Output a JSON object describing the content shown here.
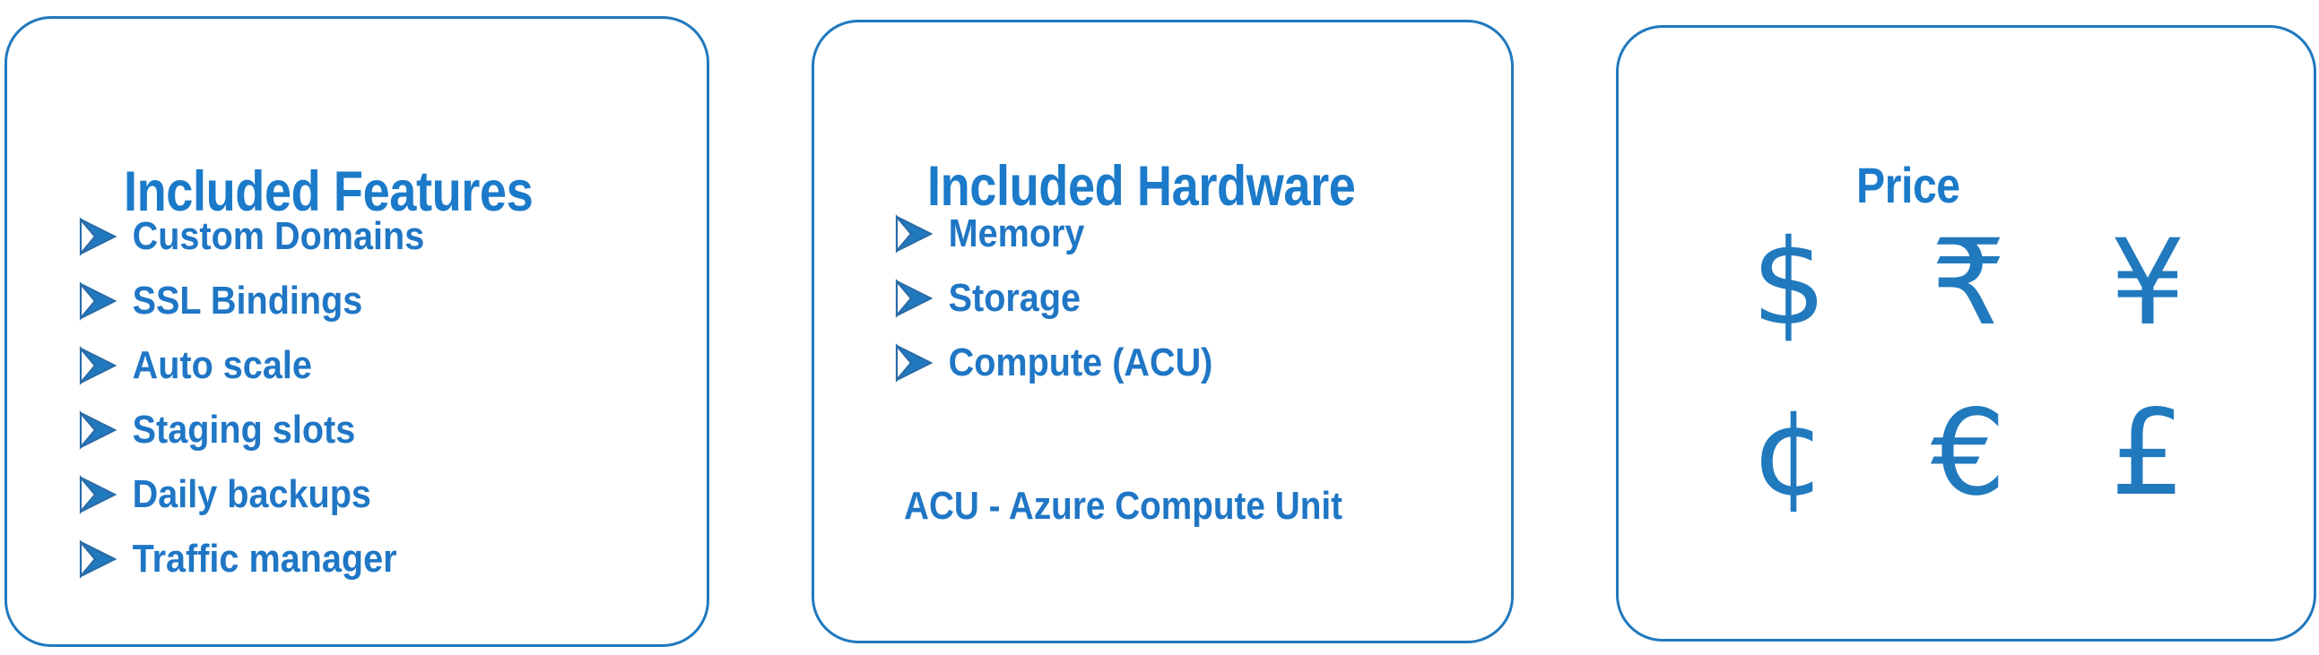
{
  "colors": {
    "border": "#2179be",
    "heading_text": "#1b7ac9",
    "body_text": "#1f76c5",
    "symbol": "#2179be",
    "background": "#ffffff"
  },
  "panels": {
    "features": {
      "title": "Included Features",
      "items": [
        {
          "bullet": "arrowhead-bullet-icon",
          "label": "Custom Domains"
        },
        {
          "bullet": "arrowhead-bullet-icon",
          "label": "SSL Bindings"
        },
        {
          "bullet": "arrowhead-bullet-icon",
          "label": "Auto scale"
        },
        {
          "bullet": "arrowhead-bullet-icon",
          "label": "Staging slots"
        },
        {
          "bullet": "arrowhead-bullet-icon",
          "label": "Daily backups"
        },
        {
          "bullet": "arrowhead-bullet-icon",
          "label": "Traffic manager"
        }
      ]
    },
    "hardware": {
      "title": "Included Hardware",
      "items": [
        {
          "bullet": "arrowhead-bullet-icon",
          "label": "Memory"
        },
        {
          "bullet": "arrowhead-bullet-icon",
          "label": "Storage"
        },
        {
          "bullet": "arrowhead-bullet-icon",
          "label": "Compute (ACU)"
        }
      ],
      "footnote": "ACU - Azure Compute Unit"
    },
    "price": {
      "title": "Price",
      "currencies": [
        {
          "icon": "dollar-sign-icon",
          "glyph": "$"
        },
        {
          "icon": "indian-rupee-sign-icon",
          "glyph": "₹"
        },
        {
          "icon": "yen-sign-icon",
          "glyph": "¥"
        },
        {
          "icon": "cent-sign-icon",
          "glyph": "¢"
        },
        {
          "icon": "euro-sign-icon",
          "glyph": "€"
        },
        {
          "icon": "pound-sign-icon",
          "glyph": "£"
        }
      ]
    }
  }
}
